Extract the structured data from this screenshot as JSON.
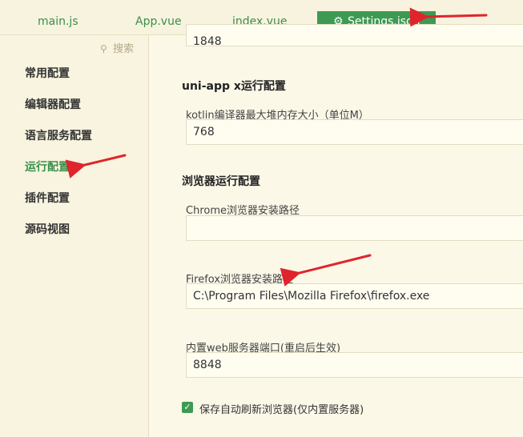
{
  "tabs": [
    {
      "label": "main.js"
    },
    {
      "label": "App.vue"
    },
    {
      "label": "index.vue"
    },
    {
      "label": "Settings.json",
      "active": true
    }
  ],
  "sidebar": {
    "search_placeholder": "搜索",
    "items": [
      {
        "label": "常用配置"
      },
      {
        "label": "编辑器配置"
      },
      {
        "label": "语言服务配置"
      },
      {
        "label": "运行配置",
        "active": true
      },
      {
        "label": "插件配置"
      },
      {
        "label": "源码视图"
      }
    ]
  },
  "main": {
    "top_partial_value": "1848",
    "section_uniapp_x": "uni-app x运行配置",
    "kotlin_label": "kotlin编译器最大堆内存大小（单位M）",
    "kotlin_value": "768",
    "section_browser": "浏览器运行配置",
    "chrome_label": "Chrome浏览器安装路径",
    "chrome_value": "",
    "firefox_label": "Firefox浏览器安装路径",
    "firefox_value": "C:\\Program Files\\Mozilla Firefox\\firefox.exe",
    "web_port_label": "内置web服务器端口(重启后生效)",
    "web_port_value": "8848",
    "auto_refresh_label": "保存自动刷新浏览器(仅内置服务器)",
    "auto_refresh_checked": true
  },
  "colors": {
    "accent": "#3d9a52",
    "arrow": "#e0242b",
    "background": "#fbf8e8"
  }
}
